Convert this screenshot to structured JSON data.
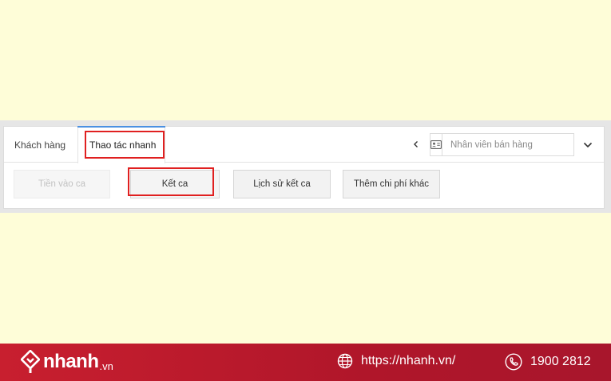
{
  "tabs": {
    "customer": "Khách hàng",
    "quick_actions": "Thao tác nhanh"
  },
  "toolbar": {
    "staff_placeholder": "Nhân viên bán hàng"
  },
  "actions": {
    "cash_in": "Tiền vào ca",
    "end_shift": "Kết ca",
    "shift_history": "Lịch sử kết ca",
    "add_expense": "Thêm chi phí khác"
  },
  "footer": {
    "brand_name": "nhanh",
    "brand_tld": ".vn",
    "website": "https://nhanh.vn/",
    "hotline": "1900 2812"
  },
  "colors": {
    "background": "#fefdd8",
    "highlight": "#e02020",
    "active_tab": "#4a90e2",
    "footer": "#c81f2f"
  },
  "icons": [
    "chevron-left-icon",
    "id-card-icon",
    "chevron-down-icon",
    "nhanh-logo-icon",
    "globe-icon",
    "phone-icon"
  ]
}
